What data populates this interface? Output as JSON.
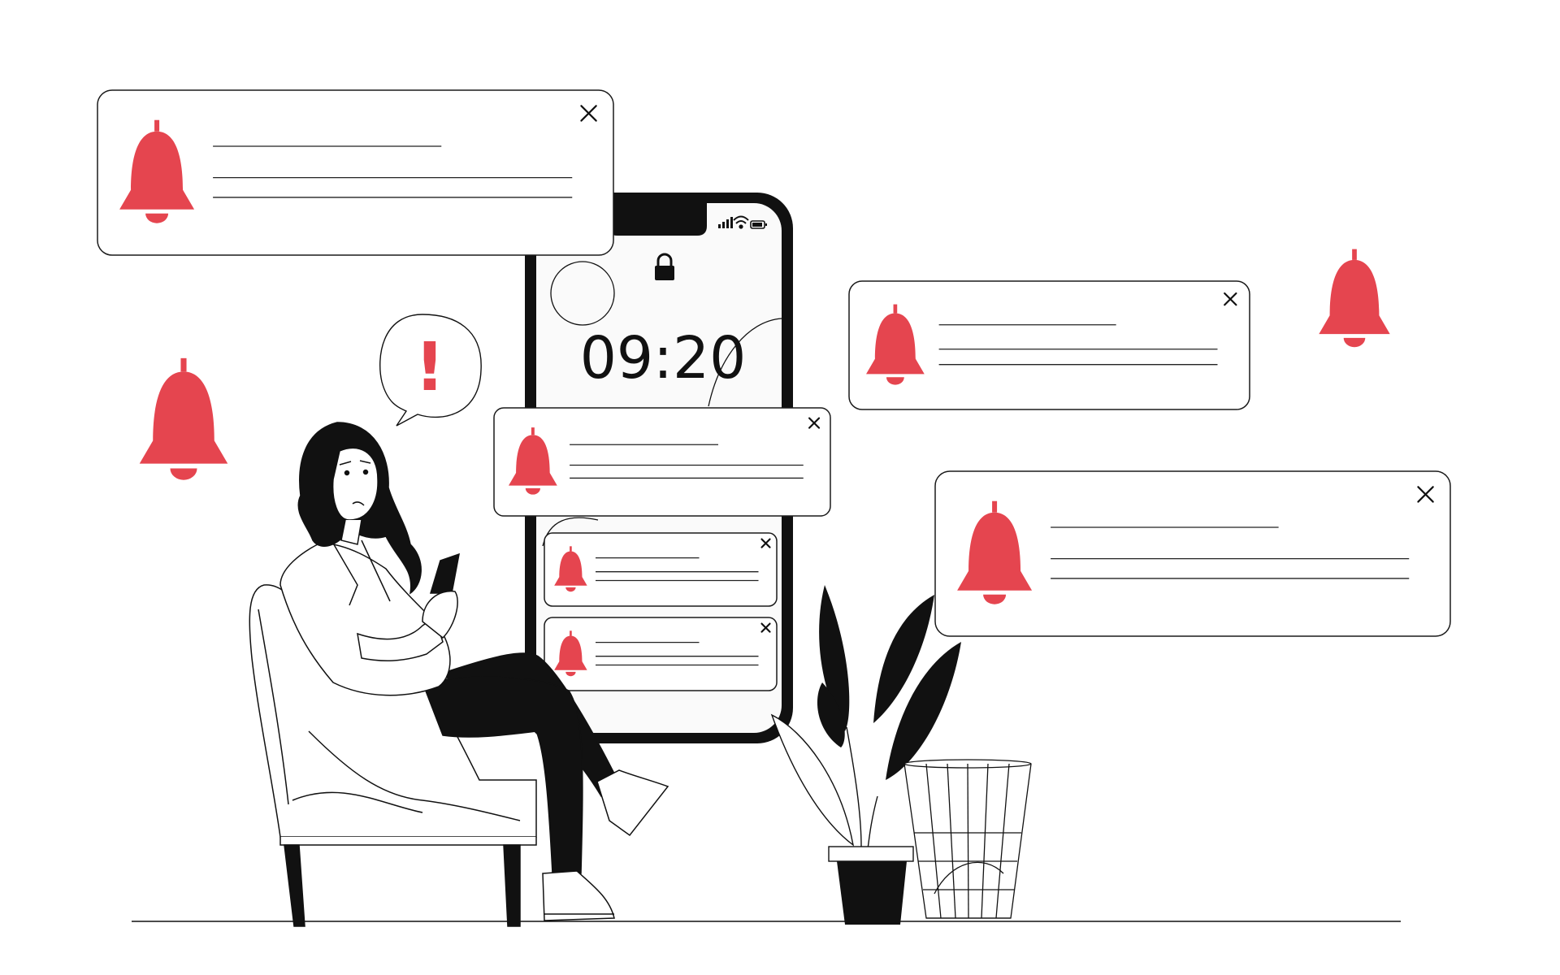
{
  "phone": {
    "clock_time": "09:20",
    "status_icons": [
      "signal-icon",
      "wifi-icon",
      "battery-icon"
    ],
    "lock_icon": "lock-icon"
  },
  "speech_bubble": {
    "symbol": "!"
  },
  "notifications": [
    {
      "id": "top-left",
      "icon": "bell-icon",
      "close_icon": "close-icon"
    },
    {
      "id": "right-upper",
      "icon": "bell-icon",
      "close_icon": "close-icon"
    },
    {
      "id": "phone-center",
      "icon": "bell-icon",
      "close_icon": "close-icon"
    },
    {
      "id": "right-lower",
      "icon": "bell-icon",
      "close_icon": "close-icon"
    },
    {
      "id": "phone-small-1",
      "icon": "bell-icon",
      "close_icon": "close-icon"
    },
    {
      "id": "phone-small-2",
      "icon": "bell-icon",
      "close_icon": "close-icon"
    }
  ],
  "colors": {
    "accent": "#E5454F",
    "ink": "#111111",
    "screen": "#FAFAFA"
  }
}
